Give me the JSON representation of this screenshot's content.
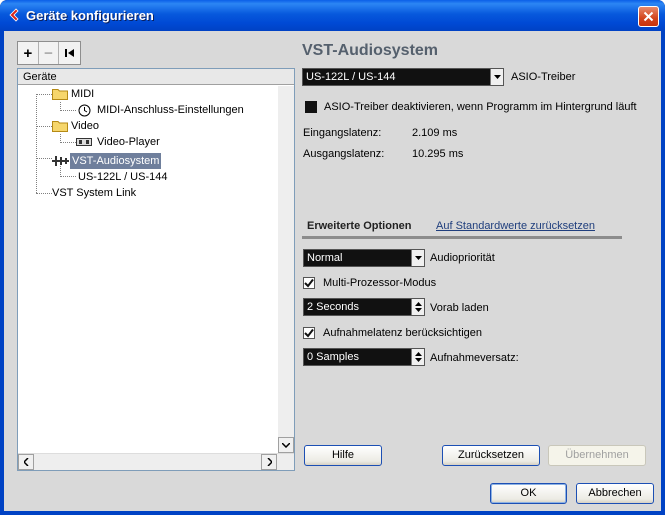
{
  "window": {
    "title": "Geräte konfigurieren"
  },
  "toolbar": {
    "add_label": "+",
    "remove_label": "−",
    "reset_label": "⏮"
  },
  "tree": {
    "header": "Geräte",
    "nodes": [
      {
        "label": "MIDI",
        "icon": "folder-icon"
      },
      {
        "label": "MIDI-Anschluss-Einstellungen",
        "icon": "midi-port-icon"
      },
      {
        "label": "Video",
        "icon": "folder-icon"
      },
      {
        "label": "Video-Player",
        "icon": "video-player-icon"
      },
      {
        "label": "VST-Audiosystem",
        "icon": "audio-system-icon",
        "selected": true
      },
      {
        "label": "US-122L / US-144"
      },
      {
        "label": "VST System Link"
      }
    ]
  },
  "panel": {
    "title": "VST-Audiosystem",
    "asio_driver": {
      "value": "US-122L / US-144",
      "label": "ASIO-Treiber"
    },
    "deactivate_checkbox": {
      "label": "ASIO-Treiber deaktivieren, wenn Programm im Hintergrund läuft",
      "checked": false
    },
    "input_latency": {
      "label": "Eingangslatenz:",
      "value": "2.109 ms"
    },
    "output_latency": {
      "label": "Ausgangslatenz:",
      "value": "10.295 ms"
    },
    "tabs": {
      "advanced": "Erweiterte Optionen",
      "reset_defaults": "Auf Standardwerte zurücksetzen"
    },
    "audio_priority": {
      "value": "Normal",
      "label": "Audiopriorität"
    },
    "multiprocessor": {
      "label": "Multi-Prozessor-Modus",
      "checked": true
    },
    "preload": {
      "value": "2 Seconds",
      "label": "Vorab laden"
    },
    "record_latency": {
      "label": "Aufnahmelatenz berücksichtigen",
      "checked": true
    },
    "record_offset": {
      "value": "0 Samples",
      "label": "Aufnahmeversatz:"
    }
  },
  "buttons": {
    "help": "Hilfe",
    "reset": "Zurücksetzen",
    "apply": "Übernehmen",
    "ok": "OK",
    "cancel": "Abbrechen"
  },
  "colors": {
    "titlebar": "#0054e3",
    "selection": "#6f7f9c",
    "combo_bg": "#111111"
  }
}
